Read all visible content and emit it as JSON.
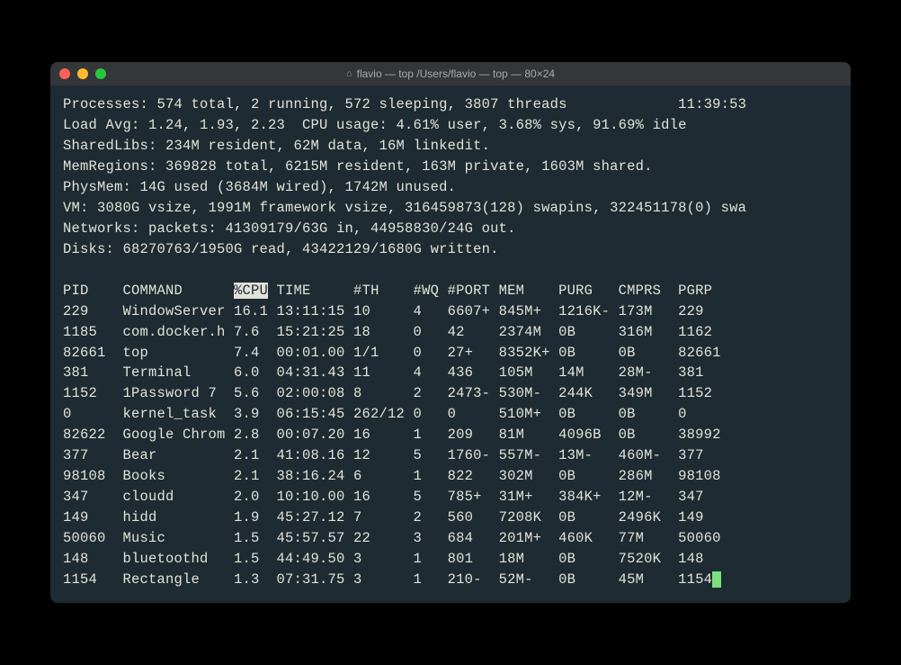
{
  "window": {
    "title_left_icon": "⌂",
    "title": "flavio — top /Users/flavio — top — 80×24"
  },
  "header": {
    "processes_line": "Processes: 574 total, 2 running, 572 sleeping, 3807 threads",
    "time": "11:39:53",
    "load_line": "Load Avg: 1.24, 1.93, 2.23  CPU usage: 4.61% user, 3.68% sys, 91.69% idle",
    "sharedlibs_line": "SharedLibs: 234M resident, 62M data, 16M linkedit.",
    "memregions_line": "MemRegions: 369828 total, 6215M resident, 163M private, 1603M shared.",
    "physmem_line": "PhysMem: 14G used (3684M wired), 1742M unused.",
    "vm_line": "VM: 3080G vsize, 1991M framework vsize, 316459873(128) swapins, 322451178(0) swa",
    "networks_line": "Networks: packets: 41309179/63G in, 44958830/24G out.",
    "disks_line": "Disks: 68270763/1950G read, 43422129/1680G written."
  },
  "columns": {
    "pid": "PID",
    "command": "COMMAND",
    "cpu": "%CPU",
    "time": "TIME",
    "th": "#TH",
    "wq": "#WQ",
    "port": "#PORT",
    "mem": "MEM",
    "purg": "PURG",
    "cmprs": "CMPRS",
    "pgrp": "PGRP"
  },
  "rows": [
    {
      "pid": "229",
      "command": "WindowServer",
      "cpu": "16.1",
      "time": "13:11:15",
      "th": "10",
      "wq": "4",
      "port": "6607+",
      "mem": "845M+",
      "purg": "1216K-",
      "cmprs": "173M",
      "pgrp": "229"
    },
    {
      "pid": "1185",
      "command": "com.docker.h",
      "cpu": "7.6",
      "time": "15:21:25",
      "th": "18",
      "wq": "0",
      "port": "42",
      "mem": "2374M",
      "purg": "0B",
      "cmprs": "316M",
      "pgrp": "1162"
    },
    {
      "pid": "82661",
      "command": "top",
      "cpu": "7.4",
      "time": "00:01.00",
      "th": "1/1",
      "wq": "0",
      "port": "27+",
      "mem": "8352K+",
      "purg": "0B",
      "cmprs": "0B",
      "pgrp": "82661"
    },
    {
      "pid": "381",
      "command": "Terminal",
      "cpu": "6.0",
      "time": "04:31.43",
      "th": "11",
      "wq": "4",
      "port": "436",
      "mem": "105M",
      "purg": "14M",
      "cmprs": "28M-",
      "pgrp": "381"
    },
    {
      "pid": "1152",
      "command": "1Password 7",
      "cpu": "5.6",
      "time": "02:00:08",
      "th": "8",
      "wq": "2",
      "port": "2473-",
      "mem": "530M-",
      "purg": "244K",
      "cmprs": "349M",
      "pgrp": "1152"
    },
    {
      "pid": "0",
      "command": "kernel_task",
      "cpu": "3.9",
      "time": "06:15:45",
      "th": "262/12",
      "wq": "0",
      "port": "0",
      "mem": "510M+",
      "purg": "0B",
      "cmprs": "0B",
      "pgrp": "0"
    },
    {
      "pid": "82622",
      "command": "Google Chrom",
      "cpu": "2.8",
      "time": "00:07.20",
      "th": "16",
      "wq": "1",
      "port": "209",
      "mem": "81M",
      "purg": "4096B",
      "cmprs": "0B",
      "pgrp": "38992"
    },
    {
      "pid": "377",
      "command": "Bear",
      "cpu": "2.1",
      "time": "41:08.16",
      "th": "12",
      "wq": "5",
      "port": "1760-",
      "mem": "557M-",
      "purg": "13M-",
      "cmprs": "460M-",
      "pgrp": "377"
    },
    {
      "pid": "98108",
      "command": "Books",
      "cpu": "2.1",
      "time": "38:16.24",
      "th": "6",
      "wq": "1",
      "port": "822",
      "mem": "302M",
      "purg": "0B",
      "cmprs": "286M",
      "pgrp": "98108"
    },
    {
      "pid": "347",
      "command": "cloudd",
      "cpu": "2.0",
      "time": "10:10.00",
      "th": "16",
      "wq": "5",
      "port": "785+",
      "mem": "31M+",
      "purg": "384K+",
      "cmprs": "12M-",
      "pgrp": "347"
    },
    {
      "pid": "149",
      "command": "hidd",
      "cpu": "1.9",
      "time": "45:27.12",
      "th": "7",
      "wq": "2",
      "port": "560",
      "mem": "7208K",
      "purg": "0B",
      "cmprs": "2496K",
      "pgrp": "149"
    },
    {
      "pid": "50060",
      "command": "Music",
      "cpu": "1.5",
      "time": "45:57.57",
      "th": "22",
      "wq": "3",
      "port": "684",
      "mem": "201M+",
      "purg": "460K",
      "cmprs": "77M",
      "pgrp": "50060"
    },
    {
      "pid": "148",
      "command": "bluetoothd",
      "cpu": "1.5",
      "time": "44:49.50",
      "th": "3",
      "wq": "1",
      "port": "801",
      "mem": "18M",
      "purg": "0B",
      "cmprs": "7520K",
      "pgrp": "148"
    },
    {
      "pid": "1154",
      "command": "Rectangle",
      "cpu": "1.3",
      "time": "07:31.75",
      "th": "3",
      "wq": "1",
      "port": "210-",
      "mem": "52M-",
      "purg": "0B",
      "cmprs": "45M",
      "pgrp": "1154"
    }
  ]
}
